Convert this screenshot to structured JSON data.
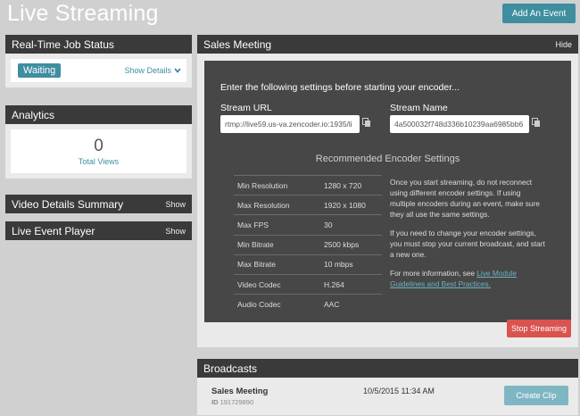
{
  "header": {
    "title": "Live Streaming",
    "add_event_label": "Add An Event"
  },
  "job_status": {
    "title": "Real-Time Job Status",
    "status": "Waiting",
    "show_details_label": "Show Details"
  },
  "analytics": {
    "title": "Analytics",
    "total_views_value": "0",
    "total_views_label": "Total Views"
  },
  "video_details": {
    "title": "Video Details Summary",
    "toggle_label": "Show"
  },
  "live_player": {
    "title": "Live Event Player",
    "toggle_label": "Show"
  },
  "event": {
    "title": "Sales Meeting",
    "hide_label": "Hide",
    "intro": "Enter the following settings before starting your encoder...",
    "stream_url_label": "Stream URL",
    "stream_url_value": "rtmp://live59.us-va.zencoder.io:1935/li",
    "stream_name_label": "Stream Name",
    "stream_name_value": "4a500032f748d336b10239aa6985bb6",
    "recommended_title": "Recommended Encoder Settings",
    "settings": [
      {
        "label": "Min Resolution",
        "value": "1280 x 720"
      },
      {
        "label": "Max Resolution",
        "value": "1920 x 1080"
      },
      {
        "label": "Max FPS",
        "value": "30"
      },
      {
        "label": "Min Bitrate",
        "value": "2500 kbps"
      },
      {
        "label": "Max Bitrate",
        "value": "10 mbps"
      },
      {
        "label": "Video Codec",
        "value": "H.264"
      },
      {
        "label": "Audio Codec",
        "value": "AAC"
      }
    ],
    "note1": "Once you start streaming, do not reconnect using different encoder settings. If using multiple encoders during an event, make sure they all use the same settings.",
    "note2": "If you need to change your encoder settings, you must stop your current broadcast, and start a new one.",
    "note3_prefix": "For more information, see ",
    "note3_link": "Live Module Guidelines and Best Practices.",
    "stop_label": "Stop Streaming"
  },
  "broadcasts": {
    "title": "Broadcasts",
    "item": {
      "name": "Sales Meeting",
      "id_label": "ID",
      "id_value": "191729890",
      "date": "10/5/2015 11:34 AM",
      "clip_label": "Create Clip"
    }
  },
  "colors": {
    "accent": "#3e8ea0",
    "danger": "#d9534f",
    "panel_header": "#3a3a3a"
  }
}
